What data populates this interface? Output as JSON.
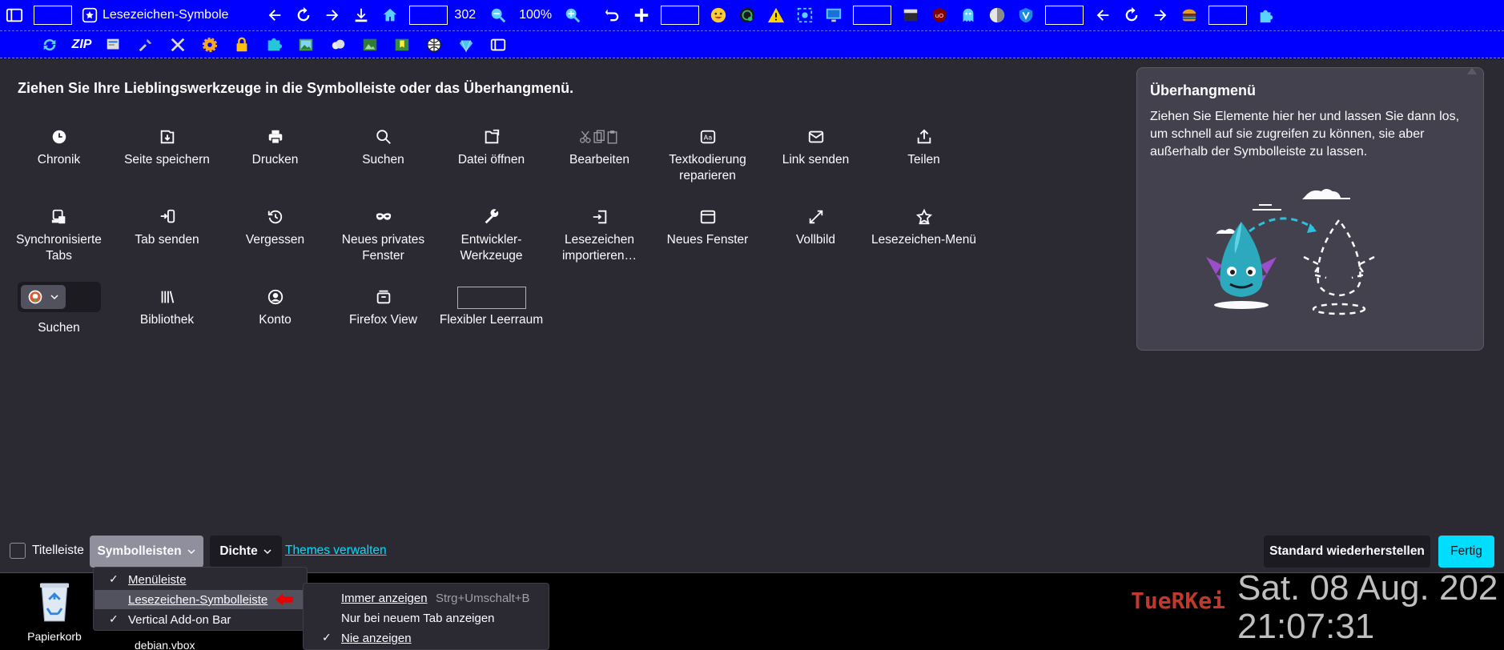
{
  "toolbar": {
    "bookmarks_label": "Lesezeichen-Symbole",
    "counter": "302",
    "zoom": "100%"
  },
  "customize": {
    "headline": "Ziehen Sie Ihre Lieblingswerkzeuge in die Symbolleiste oder das Überhangmenü.",
    "tools": [
      {
        "label": "Chronik",
        "icon": "clock-icon"
      },
      {
        "label": "Seite speichern",
        "icon": "save-page-icon"
      },
      {
        "label": "Drucken",
        "icon": "printer-icon"
      },
      {
        "label": "Suchen",
        "icon": "search-icon"
      },
      {
        "label": "Datei öffnen",
        "icon": "open-file-icon"
      },
      {
        "label": "Bearbeiten",
        "icon": "edit-cut-copy-paste-icon"
      },
      {
        "label": "Textkodierung reparieren",
        "icon": "text-encoding-icon"
      },
      {
        "label": "Link senden",
        "icon": "mail-icon"
      },
      {
        "label": "Teilen",
        "icon": "share-icon"
      },
      {
        "label": "Synchronisierte Tabs",
        "icon": "synced-tabs-icon"
      },
      {
        "label": "Tab senden",
        "icon": "send-tab-icon"
      },
      {
        "label": "Vergessen",
        "icon": "forget-icon"
      },
      {
        "label": "Neues privates Fenster",
        "icon": "private-mask-icon"
      },
      {
        "label": "Entwickler-Werkzeuge",
        "icon": "wrench-icon"
      },
      {
        "label": "Lesezeichen importieren…",
        "icon": "import-icon"
      },
      {
        "label": "Neues Fenster",
        "icon": "new-window-icon"
      },
      {
        "label": "Vollbild",
        "icon": "fullscreen-icon"
      },
      {
        "label": "Lesezeichen-Menü",
        "icon": "bookmark-star-icon"
      },
      {
        "label": "Suchen",
        "icon": "search-engine-icon"
      },
      {
        "label": "Bibliothek",
        "icon": "library-icon"
      },
      {
        "label": "Konto",
        "icon": "account-icon"
      },
      {
        "label": "Firefox View",
        "icon": "firefox-view-icon"
      },
      {
        "label": "Flexibler Leerraum",
        "icon": "flexible-space"
      }
    ],
    "overflow": {
      "title": "Überhangmenü",
      "text": "Ziehen Sie Elemente hier her und lassen Sie dann los, um schnell auf sie zugreifen zu können, sie aber außerhalb der Symbolleiste zu lassen."
    }
  },
  "bottom": {
    "titlebar_label": "Titelleiste",
    "toolbars_button": "Symbolleisten",
    "density_button": "Dichte",
    "themes_link": "Themes verwalten",
    "reset_button": "Standard wiederherstellen",
    "done_button": "Fertig"
  },
  "toolbars_menu": {
    "items": [
      {
        "label": "Menüleiste",
        "checked": true
      },
      {
        "label": "Lesezeichen-Symbolleiste",
        "checked": false
      },
      {
        "label": "Vertical Add-on Bar",
        "checked": true
      }
    ]
  },
  "bookmarks_submenu": {
    "items": [
      {
        "label": "Immer anzeigen",
        "shortcut": "Strg+Umschalt+B",
        "checked": false
      },
      {
        "label": "Nur bei neuem Tab anzeigen",
        "shortcut": "",
        "checked": false
      },
      {
        "label": "Nie anzeigen",
        "shortcut": "",
        "checked": true
      }
    ]
  },
  "desktop": {
    "recycle_bin": "Papierkorb",
    "file": "debian.vbox",
    "brand": "TueRKei",
    "date": "Sat. 08 Aug. 202",
    "time": "21:07:31"
  },
  "colors": {
    "toolbar_blue": "#0000ff",
    "panel_bg": "#2b2a33",
    "accent": "#00ddff"
  }
}
